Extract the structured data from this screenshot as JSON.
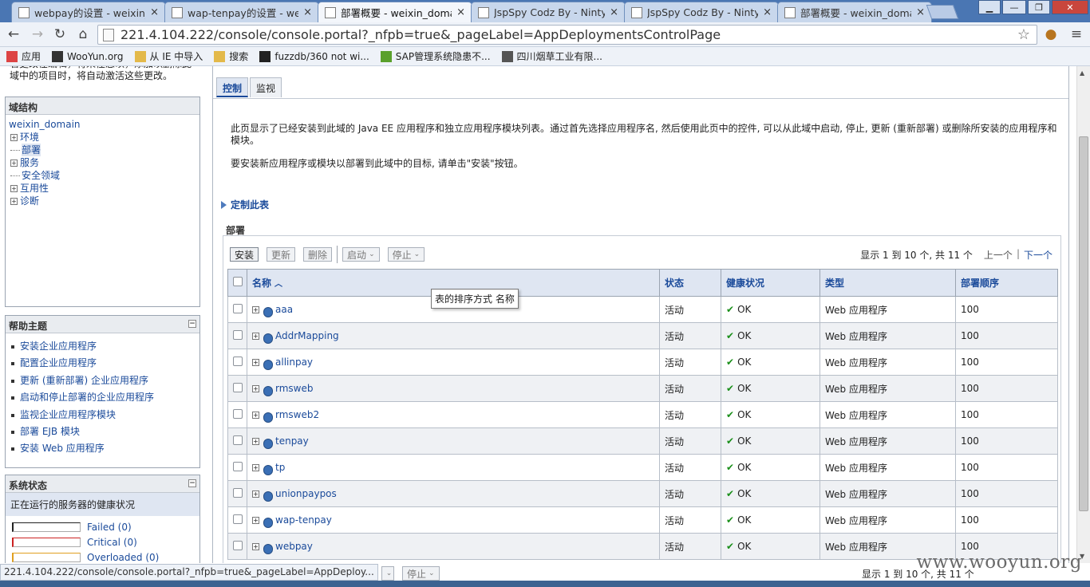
{
  "browser": {
    "tabs": [
      {
        "title": "webpay的设置 - weixin_",
        "close": "×"
      },
      {
        "title": "wap-tenpay的设置 - wei",
        "close": "×"
      },
      {
        "title": "部署概要 - weixin_domai",
        "close": "×"
      },
      {
        "title": "JspSpy Codz By - Ninty",
        "close": "×"
      },
      {
        "title": "JspSpy Codz By - Ninty",
        "close": "×"
      },
      {
        "title": "部署概要 - weixin_domai",
        "close": "×"
      }
    ],
    "url": "221.4.104.222/console/console.portal?_nfpb=true&_pageLabel=AppDeploymentsControlPage",
    "bookmarks": [
      {
        "label": "应用",
        "icon": "apps-grid-icon",
        "color": "#d44"
      },
      {
        "label": "WooYun.org",
        "icon": "wooyun-icon",
        "color": "#333"
      },
      {
        "label": "从 IE 中导入",
        "icon": "folder-icon",
        "color": "#e3b94a"
      },
      {
        "label": "搜索",
        "icon": "folder-icon",
        "color": "#e3b94a"
      },
      {
        "label": "fuzzdb/360 not wi...",
        "icon": "github-icon",
        "color": "#222"
      },
      {
        "label": "SAP管理系统隐患不...",
        "icon": "check-icon",
        "color": "#5aa02c"
      },
      {
        "label": "四川烟草工业有限...",
        "icon": "site-icon",
        "color": "#555"
      }
    ],
    "status_url": "221.4.104.222/console/console.portal?_nfpb=true&_pageLabel=AppDeploy..."
  },
  "left": {
    "change_center_text": "若更改在编辑，将来任您以，添加以删除此域中的项目时，将自动激活这些更改。",
    "domain_structure": {
      "title": "域结构",
      "root": "weixin_domain",
      "items": [
        {
          "label": "环境",
          "expandable": true,
          "selected": false
        },
        {
          "label": "部署",
          "expandable": false,
          "selected": true
        },
        {
          "label": "服务",
          "expandable": true,
          "selected": false
        },
        {
          "label": "安全领域",
          "expandable": false,
          "selected": false
        },
        {
          "label": "互用性",
          "expandable": true,
          "selected": false
        },
        {
          "label": "诊断",
          "expandable": true,
          "selected": false
        }
      ]
    },
    "help": {
      "title": "帮助主题",
      "items": [
        "安装企业应用程序",
        "配置企业应用程序",
        "更新 (重新部署) 企业应用程序",
        "启动和停止部署的企业应用程序",
        "监视企业应用程序模块",
        "部署 EJB 模块",
        "安装 Web 应用程序"
      ]
    },
    "system_status": {
      "title": "系统状态",
      "subtitle": "正在运行的服务器的健康状况",
      "rows": [
        {
          "label": "Failed (0)",
          "color": "#222222"
        },
        {
          "label": "Critical (0)",
          "color": "#cc2222"
        },
        {
          "label": "Overloaded (0)",
          "color": "#e0a020"
        }
      ]
    }
  },
  "main": {
    "tabs": [
      "控制",
      "监视"
    ],
    "description_1": "此页显示了已经安装到此域的 Java EE 应用程序和独立应用程序模块列表。通过首先选择应用程序名, 然后使用此页中的控件, 可以从此域中启动, 停止, 更新 (重新部署) 或删除所安装的应用程序和模块。",
    "description_2": "要安装新应用程序或模块以部署到此域中的目标, 请单击\"安装\"按钮。",
    "customize_label": "定制此表",
    "deployments_title": "部署",
    "buttons": {
      "install": "安装",
      "update": "更新",
      "delete": "删除",
      "start": "启动",
      "stop": "停止"
    },
    "pager": {
      "summary": "显示 1 到 10 个, 共 11 个",
      "prev": "上一个",
      "sep": "|",
      "next": "下一个"
    },
    "table": {
      "headers": [
        "名称",
        "状态",
        "健康状况",
        "类型",
        "部署顺序"
      ],
      "rows": [
        {
          "name": "aaa",
          "state": "活动",
          "health": "OK",
          "type": "Web 应用程序",
          "order": "100"
        },
        {
          "name": "AddrMapping",
          "state": "活动",
          "health": "OK",
          "type": "Web 应用程序",
          "order": "100"
        },
        {
          "name": "allinpay",
          "state": "活动",
          "health": "OK",
          "type": "Web 应用程序",
          "order": "100"
        },
        {
          "name": "rmsweb",
          "state": "活动",
          "health": "OK",
          "type": "Web 应用程序",
          "order": "100"
        },
        {
          "name": "rmsweb2",
          "state": "活动",
          "health": "OK",
          "type": "Web 应用程序",
          "order": "100"
        },
        {
          "name": "tenpay",
          "state": "活动",
          "health": "OK",
          "type": "Web 应用程序",
          "order": "100"
        },
        {
          "name": "tp",
          "state": "活动",
          "health": "OK",
          "type": "Web 应用程序",
          "order": "100"
        },
        {
          "name": "unionpaypos",
          "state": "活动",
          "health": "OK",
          "type": "Web 应用程序",
          "order": "100"
        },
        {
          "name": "wap-tenpay",
          "state": "活动",
          "health": "OK",
          "type": "Web 应用程序",
          "order": "100"
        },
        {
          "name": "webpay",
          "state": "活动",
          "health": "OK",
          "type": "Web 应用程序",
          "order": "100"
        }
      ]
    },
    "tooltip": "表的排序方式 名称"
  },
  "watermark": "www.wooyun.org"
}
